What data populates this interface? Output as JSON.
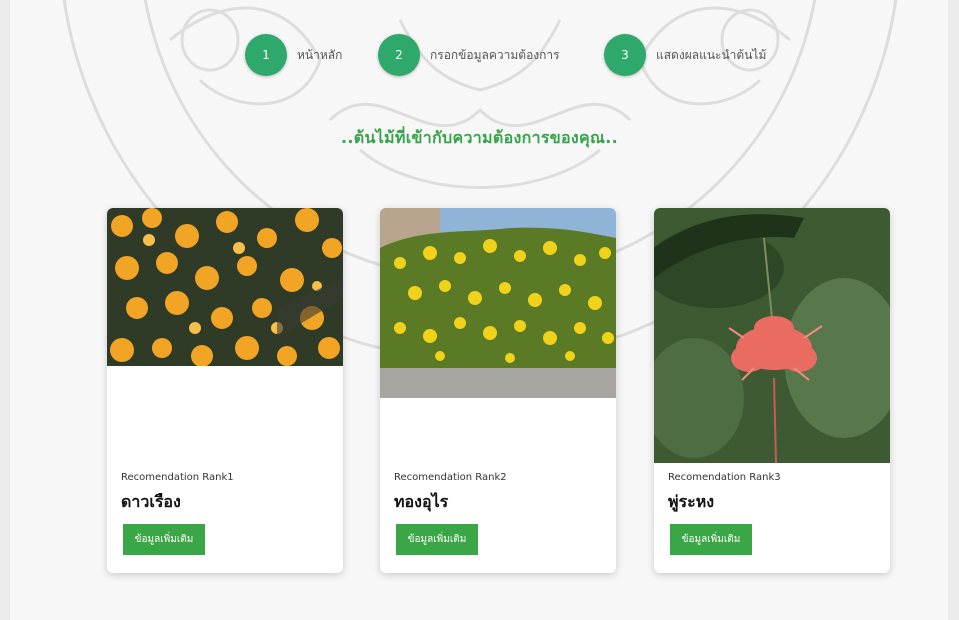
{
  "steps": [
    {
      "number": "1",
      "label": "หน้าหลัก"
    },
    {
      "number": "2",
      "label": "กรอกข้อมูลความต้องการ"
    },
    {
      "number": "3",
      "label": "แสดงผลแนะนำต้นไม้"
    }
  ],
  "headline": "..ต้นไม้ที่เข้ากับความต้องการของคุณ..",
  "cards": [
    {
      "rank": "Recomendation Rank1",
      "name": "ดาวเรือง",
      "button": "ข้อมูลเพิ่มเติม"
    },
    {
      "rank": "Recomendation Rank2",
      "name": "ทองอุไร",
      "button": "ข้อมูลเพิ่มเติม"
    },
    {
      "rank": "Recomendation Rank3",
      "name": "พู่ระหง",
      "button": "ข้อมูลเพิ่มเติม"
    }
  ],
  "colors": {
    "accent": "#2ea86b",
    "button": "#3aa646",
    "headline": "#37a34a"
  }
}
